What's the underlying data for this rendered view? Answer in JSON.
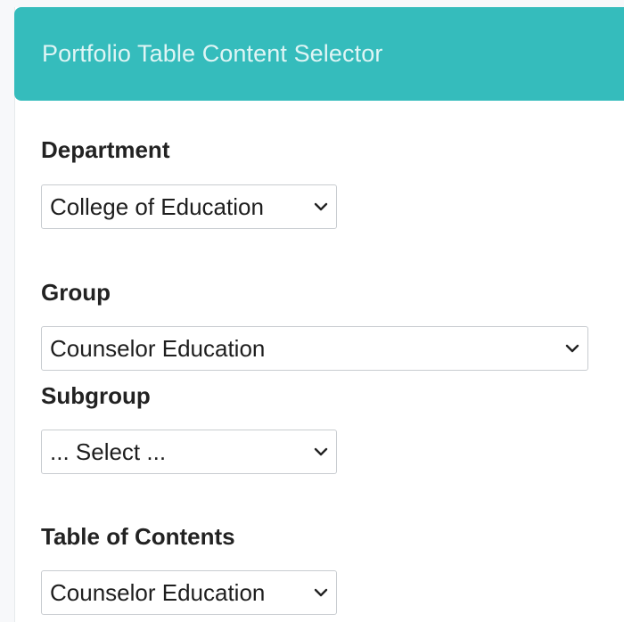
{
  "header": {
    "title": "Portfolio Table Content Selector"
  },
  "form": {
    "department": {
      "label": "Department",
      "selected": "College of Education"
    },
    "group": {
      "label": "Group",
      "selected": "Counselor Education"
    },
    "subgroup": {
      "label": "Subgroup",
      "selected": "... Select ..."
    },
    "table_of_contents": {
      "label": "Table of Contents",
      "selected": "Counselor Education"
    }
  },
  "icons": {
    "select_arrow": "chevron-down-icon"
  },
  "colors": {
    "header_background": "#35bcbc",
    "header_text": "#dff5f5"
  }
}
